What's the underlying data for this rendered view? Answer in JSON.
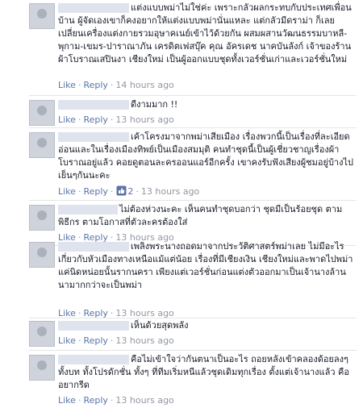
{
  "actions": {
    "like_label": "Like",
    "reply_label": "Reply",
    "separator": "·"
  },
  "comments": [
    {
      "text": "แต่งแบบพม่าไม่ใช่ค่ะ เพราะกลัวผลกระทบกับประเทศเพื่อนบ้าน ผู้จัดเองเขาก็คงอยากให้แต่งแบบพม่านั่นแหละ แต่กลัวมีดราม่า ก็เลยเปลี่ยนเครื่องแต่งกายรวมอุษาคเนย์เข้าไว้ด้วยกัน ผสมผสานวัฒนธรรมบาหลี-พุกาม-เขมร-ปาราณาภัน เครดิตเฟสบุ๊ค คุณ อัครเดช นาคบันลังก์ เจ้าของร้านผ้าโบราณเสปินงา เชียงใหม่ เป็นผู้ออกแบบชุดทั้งเวอร์ชั่นเก่าและเวอร์ชั่นใหม่",
      "time": "14 hours ago"
    },
    {
      "text": "ดีงามมาก !!",
      "time": "13 hours ago"
    },
    {
      "text": "เค้าโครงมาจากพม่าเสียเมือง เรื่องพวกนี้เป็นเรื่องที่ละเอียดอ่อนและในเรื่องเมืองทิพย์เป็นเมืองสมมุติ คนทำชุดนี้เป็นผู้เชี่ยวชาญเรื่องผ้าโบราณอยู่แล้ว คอยดูตอนละครออนแอร์อีกครั้ง เขาคงรับฟังเสียงผู้ชมอยู่บ้างไปเย็นๆกันนะคะ",
      "likes": "2",
      "time": "13 hours ago"
    },
    {
      "text": "ไม่ต้องห่วงนะคะ เห็นคนทำชุดบอกว่า ชุดมีเป็นร้อยชุด ตามพิธีกร ตามโอกาสที่ตัวละครต้องใส่",
      "time": "13 hours ago"
    },
    {
      "text": "เพลิงพระนางถอดมาจากประวัติศาสตร์พม่าเลย ไม่มีอะไรเกี่ยวกับหัวเมืองทางเหนือแม้แต่น้อย เรื่องที่มีเชียงเงิน เชียงใหม่และพาดไปพม่าแค่นิดหน่อยนั้นรากนครา เพียงแต่เวอร์ชั่นก่อนแต่งตัวออกมาเป็นเจ้านางล้านนามากกว่าจะเป็นพม่า",
      "time": "13 hours ago"
    },
    {
      "text": "เห็นด้วยสุดพลัง",
      "time": "13 hours ago"
    },
    {
      "text": "คือไม่เข้าใจว่ากันตนาเป็นอะไร ถอยหลังเข้าคลองด้อยลงๆ ทั้งบท ทั้งโปรดักชั่น ทั้งๆ ที่ทีมเริ่มหนีแล้วชุดเดิมทุกเรื่อง ตั้งแต่เจ้านางแล้ว คืออยากรีด",
      "time": "13 hours ago"
    }
  ]
}
